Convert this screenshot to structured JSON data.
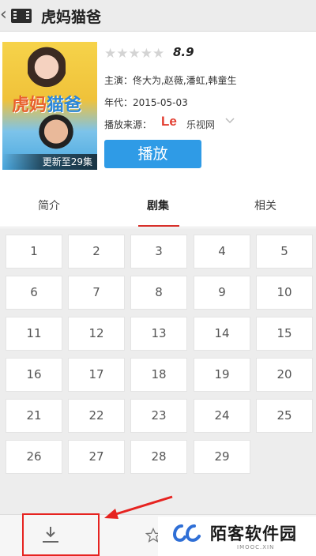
{
  "app": {
    "title": "虎妈猫爸"
  },
  "poster": {
    "logo_part1": "虎妈",
    "logo_part2": "猫爸",
    "badge": "更新至29集"
  },
  "details": {
    "stars": "★★★★★",
    "rating": "8.9",
    "cast": "主演：佟大为,赵薇,潘虹,韩童生",
    "year": "年代：2015-05-03",
    "source_label": "播放来源：",
    "source_logo": "Le",
    "source_name": "乐视网",
    "play_label": "播放"
  },
  "tabs": [
    {
      "label": "简介",
      "active": false
    },
    {
      "label": "剧集",
      "active": true
    },
    {
      "label": "相关",
      "active": false
    }
  ],
  "episodes": [
    "1",
    "2",
    "3",
    "4",
    "5",
    "6",
    "7",
    "8",
    "9",
    "10",
    "11",
    "12",
    "13",
    "14",
    "15",
    "16",
    "17",
    "18",
    "19",
    "20",
    "21",
    "22",
    "23",
    "24",
    "25",
    "26",
    "27",
    "28",
    "29"
  ],
  "icons": {
    "back": "back-chevron-icon",
    "title": "film-icon",
    "download": "download-icon",
    "favorite": "star-outline-icon",
    "annotation": "red-arrow"
  },
  "watermark": {
    "name": "陌客软件园",
    "sub": "IMOOC.XIN"
  },
  "colors": {
    "accent": "#2f9be6",
    "tab_indicator": "#d9302a",
    "annotation": "#e62320",
    "source_brand": "#e23b2e"
  }
}
